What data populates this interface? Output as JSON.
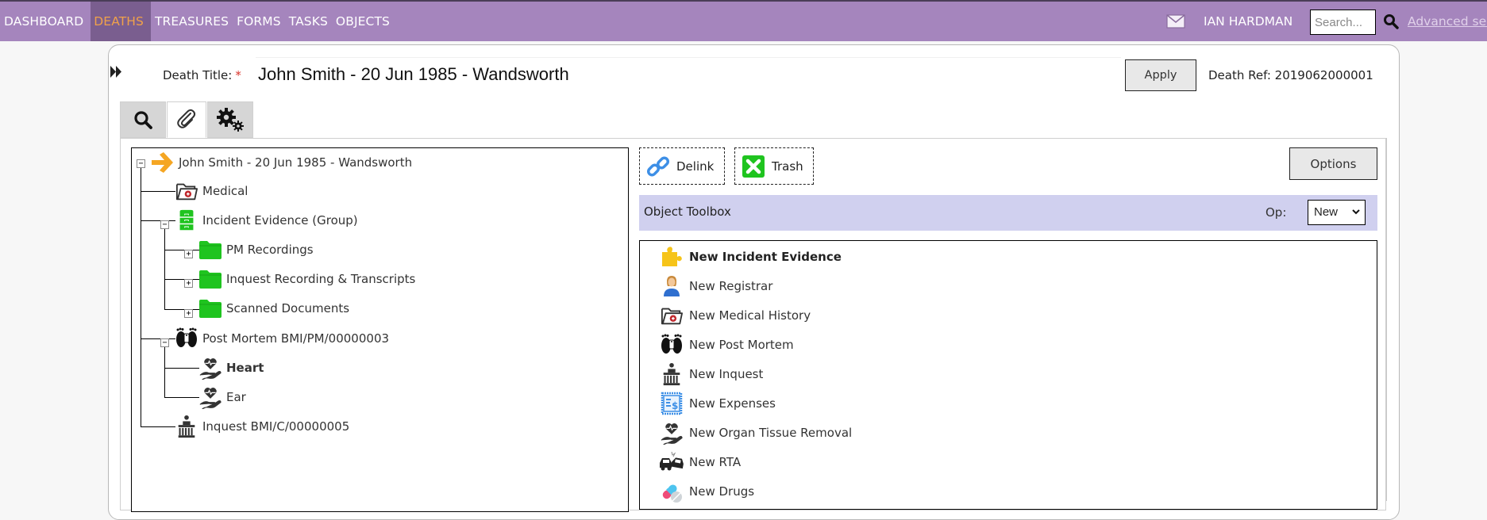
{
  "nav": {
    "items": [
      {
        "label": "DASHBOARD",
        "active": false
      },
      {
        "label": "DEATHS",
        "active": true
      },
      {
        "label": "TREASURES",
        "active": false
      },
      {
        "label": "FORMS",
        "active": false
      },
      {
        "label": "TASKS",
        "active": false
      },
      {
        "label": "OBJECTS",
        "active": false
      }
    ],
    "user_name": "IAN HARDMAN",
    "search_placeholder": "Search...",
    "advanced_search_label": "Advanced search",
    "mail_icon": "envelope-icon",
    "search_icon": "magnifier-icon"
  },
  "colors": {
    "nav_bg": "#a585bd",
    "nav_active_bg": "#7a5e8f",
    "nav_active_text": "#f0a14a",
    "toolbox_bar": "#d0d0ef",
    "folder_green": "#1fc41f",
    "arrow_orange": "#f5a623"
  },
  "header": {
    "title_label": "Death Title:",
    "required_mark": "*",
    "title_value": "John Smith - 20 Jun 1985 - Wandsworth",
    "apply_label": "Apply",
    "death_ref": "Death Ref: 2019062000001"
  },
  "tabs": [
    {
      "name": "search",
      "icon": "magnifier-icon",
      "active": false
    },
    {
      "name": "attachments",
      "icon": "paperclip-icon",
      "active": true
    },
    {
      "name": "settings",
      "icon": "gears-icon",
      "active": false
    }
  ],
  "tree": {
    "nodes": [
      {
        "label": "John Smith - 20 Jun 1985 - Wandsworth",
        "icon": "arrow-right-icon",
        "level": 0,
        "expanded": true,
        "bold": false
      },
      {
        "label": "Medical",
        "icon": "medical-folder-icon",
        "level": 1,
        "bold": false
      },
      {
        "label": "Incident Evidence (Group)",
        "icon": "filing-cabinet-icon",
        "level": 1,
        "expanded": true,
        "bold": false
      },
      {
        "label": "PM Recordings",
        "icon": "green-folder-icon",
        "level": 2,
        "expanded": false,
        "bold": false
      },
      {
        "label": "Inquest Recording & Transcripts",
        "icon": "green-folder-icon",
        "level": 2,
        "expanded": false,
        "bold": false
      },
      {
        "label": "Scanned Documents",
        "icon": "green-folder-icon",
        "level": 2,
        "expanded": false,
        "bold": false
      },
      {
        "label": "Post Mortem BMI/PM/00000003",
        "icon": "feet-tag-icon",
        "level": 1,
        "expanded": true,
        "bold": false
      },
      {
        "label": "Heart",
        "icon": "heart-hand-icon",
        "level": 2,
        "bold": true
      },
      {
        "label": "Ear",
        "icon": "heart-hand-icon",
        "level": 2,
        "bold": false
      },
      {
        "label": "Inquest BMI/C/00000005",
        "icon": "courthouse-icon",
        "level": 1,
        "bold": false
      }
    ]
  },
  "actions": {
    "delink_label": "Delink",
    "trash_label": "Trash",
    "options_label": "Options"
  },
  "toolbox": {
    "title": "Object Toolbox",
    "op_label": "Op:",
    "op_value": "New",
    "items": [
      {
        "label": "New Incident Evidence",
        "icon": "puzzle-piece-icon",
        "bold": true
      },
      {
        "label": "New Registrar",
        "icon": "person-icon",
        "bold": false
      },
      {
        "label": "New Medical History",
        "icon": "medical-folder-icon",
        "bold": false
      },
      {
        "label": "New Post Mortem",
        "icon": "feet-tag-icon",
        "bold": false
      },
      {
        "label": "New Inquest",
        "icon": "courthouse-icon",
        "bold": false
      },
      {
        "label": "New Expenses",
        "icon": "receipt-dollar-icon",
        "bold": false
      },
      {
        "label": "New Organ Tissue Removal",
        "icon": "heart-hand-icon",
        "bold": false
      },
      {
        "label": "New RTA",
        "icon": "car-crash-icon",
        "bold": false
      },
      {
        "label": "New Drugs",
        "icon": "pills-icon",
        "bold": false
      }
    ]
  }
}
